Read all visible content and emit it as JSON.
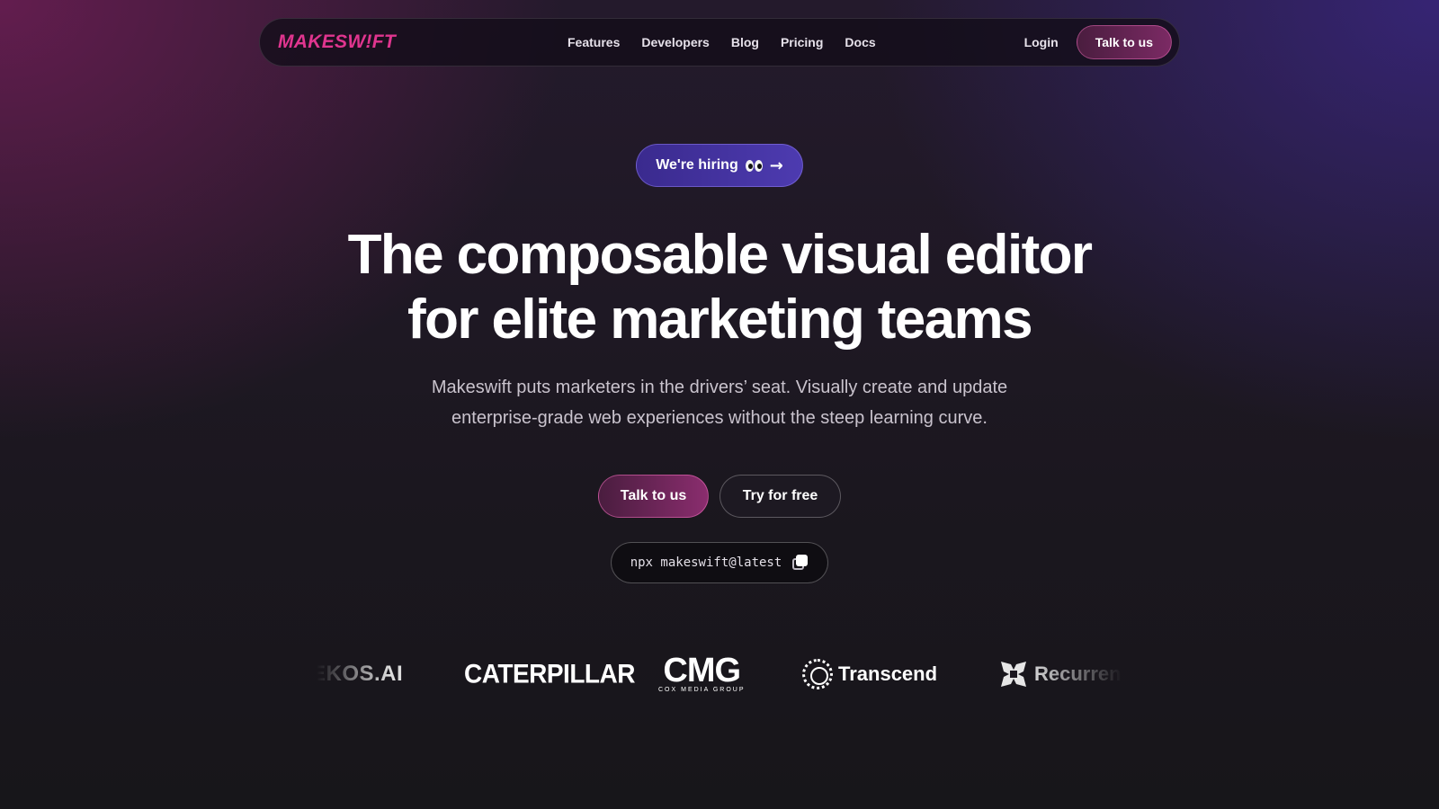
{
  "nav": {
    "logo": "MAKESW!FT",
    "links": [
      "Features",
      "Developers",
      "Blog",
      "Pricing",
      "Docs"
    ],
    "login": "Login",
    "cta": "Talk to us"
  },
  "hiring_badge": {
    "label": "We're hiring"
  },
  "hero": {
    "headline_line1": "The composable visual editor",
    "headline_line2": "for elite marketing teams",
    "subhead_line1": "Makeswift puts marketers in the drivers’ seat. Visually create and update",
    "subhead_line2": "enterprise-grade web experiences without the steep learning curve."
  },
  "cta": {
    "primary": "Talk to us",
    "secondary": "Try for free",
    "command": "npx makeswift@latest"
  },
  "logos": {
    "ekos": "EKOS.AI",
    "caterpillar": "CATERPILLAR",
    "cmg": "CMG",
    "cmg_sub": "COX MEDIA GROUP",
    "transcend": "Transcend",
    "recurrency": "Recurrency"
  },
  "colors": {
    "brand_pink": "#e0358f",
    "hiring_purple": "#4d3bb0",
    "cta_gradient_end": "#8a2d6e"
  },
  "icons": [
    "eyes-emoji-icon",
    "arrow-right-icon",
    "copy-icon",
    "transcend-logo-icon",
    "recurrency-logo-icon"
  ]
}
